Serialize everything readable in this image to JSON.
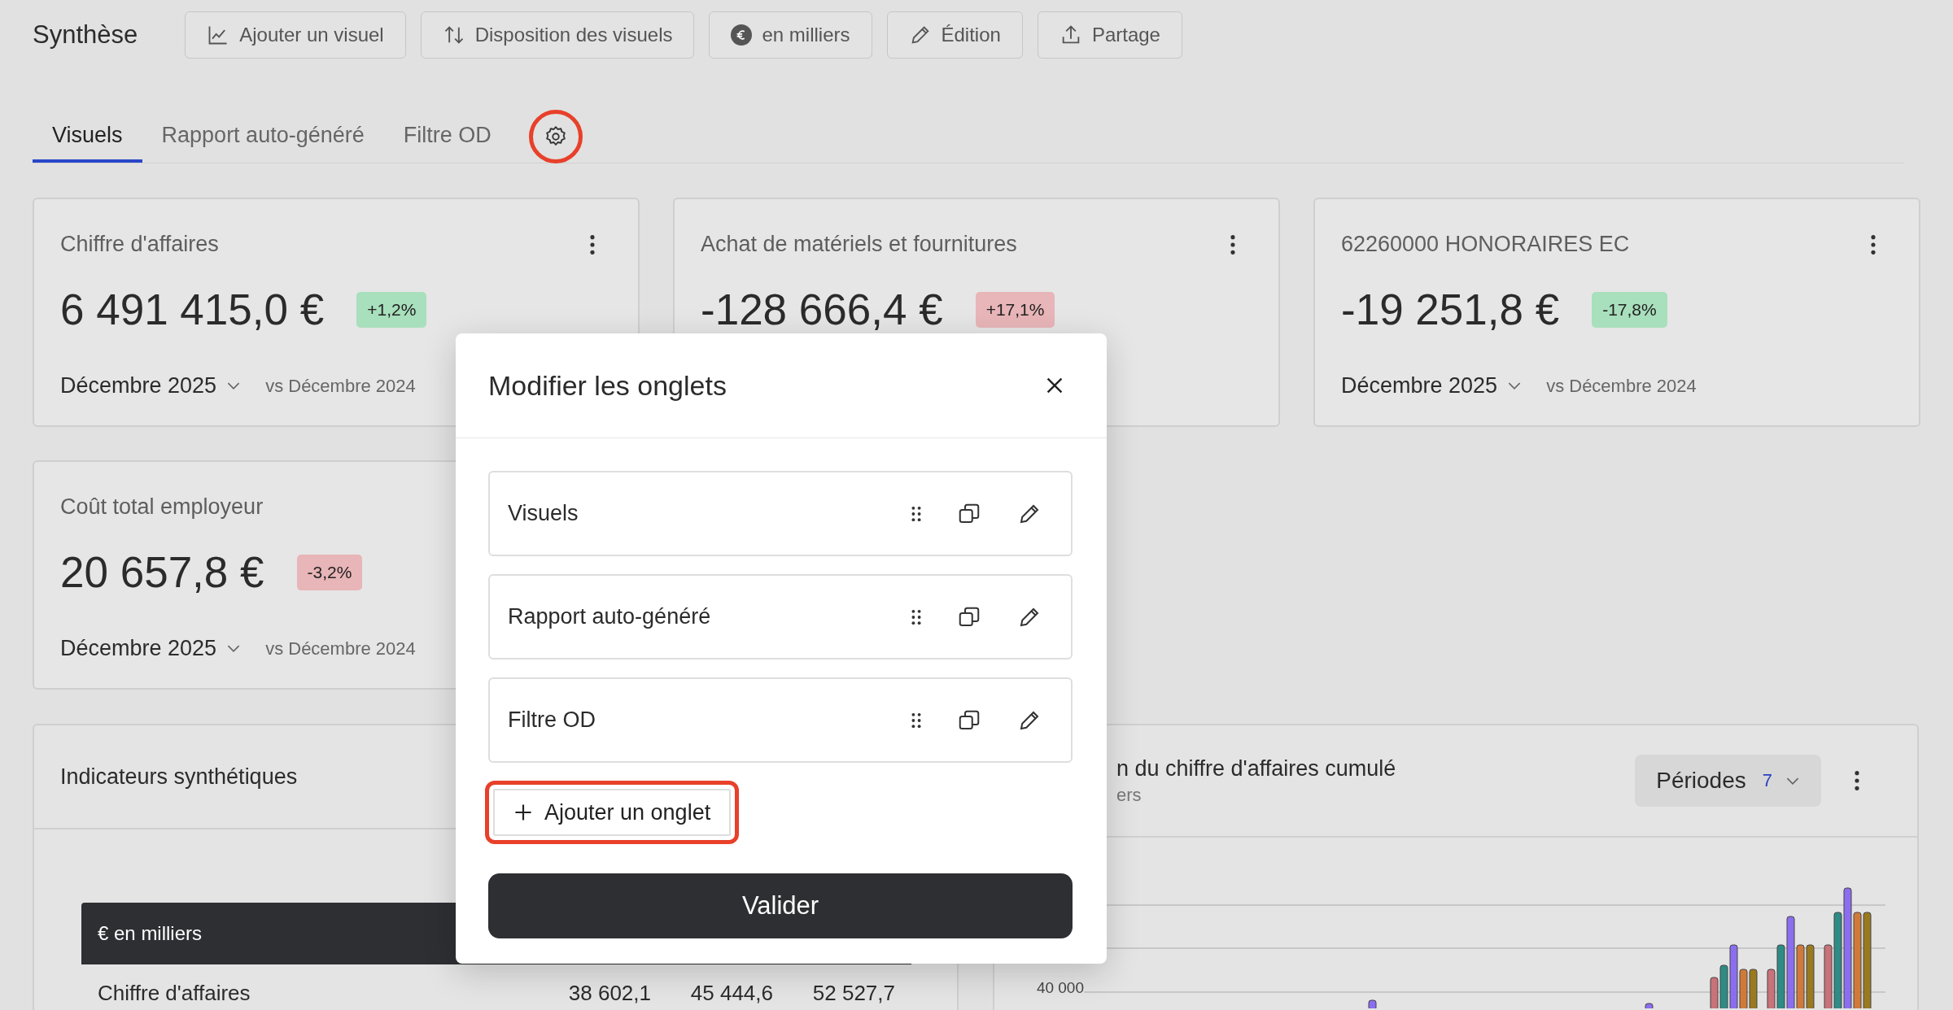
{
  "page": {
    "title": "Synthèse"
  },
  "toolbar": [
    {
      "label": "Ajouter un visuel"
    },
    {
      "label": "Disposition des visuels"
    },
    {
      "label": "en milliers"
    },
    {
      "label": "Édition"
    },
    {
      "label": "Partage"
    }
  ],
  "tabs": [
    {
      "label": "Visuels",
      "selected": true
    },
    {
      "label": "Rapport auto-généré",
      "selected": false
    },
    {
      "label": "Filtre OD",
      "selected": false
    }
  ],
  "tab_settings": {
    "highlighted": true
  },
  "kpi_cards": [
    {
      "title": "Chiffre d'affaires",
      "value": "6 491 415,0 €",
      "change": "+1,2%",
      "color": "#a8dfbc",
      "period": "Décembre 2025",
      "comparison": "vs Décembre 2024"
    },
    {
      "title": "Achat de matériels et fournitures",
      "value": "-128 666,4 €",
      "change": "+17,1%",
      "color": "#e8b5b8"
    },
    {
      "title": "62260000 HONORAIRES EC",
      "value": "-19 251,8 €",
      "change": "-17,8%",
      "color": "#a8dfbc",
      "period": "Décembre 2025",
      "comparison": "vs Décembre 2024"
    },
    {
      "title": "Coût total employeur",
      "value": "20 657,8 €",
      "change": "-3,2%",
      "color": "#e8b5b8",
      "period": "Décembre 2025",
      "comparison": "vs Décembre 2024"
    }
  ],
  "indicators_panel": {
    "title": "Indicateurs synthétiques",
    "table_header": "€ en milliers",
    "rows": [
      {
        "label": "Chiffre d'affaires",
        "values": [
          "38 602,1",
          "45 444,6",
          "52 527,7"
        ]
      }
    ]
  },
  "chart_panel": {
    "title": "n du chiffre d'affaires cumulé",
    "subtitle": "ers",
    "periods_label": "Périodes",
    "periods_count": "7",
    "y_tick": "40 000"
  },
  "modal": {
    "title": "Modifier les onglets",
    "tabs": [
      {
        "label": "Visuels"
      },
      {
        "label": "Rapport auto-généré"
      },
      {
        "label": "Filtre OD"
      }
    ],
    "add_button": {
      "label": "Ajouter un onglet",
      "highlighted": true
    },
    "submit": "Valider"
  }
}
